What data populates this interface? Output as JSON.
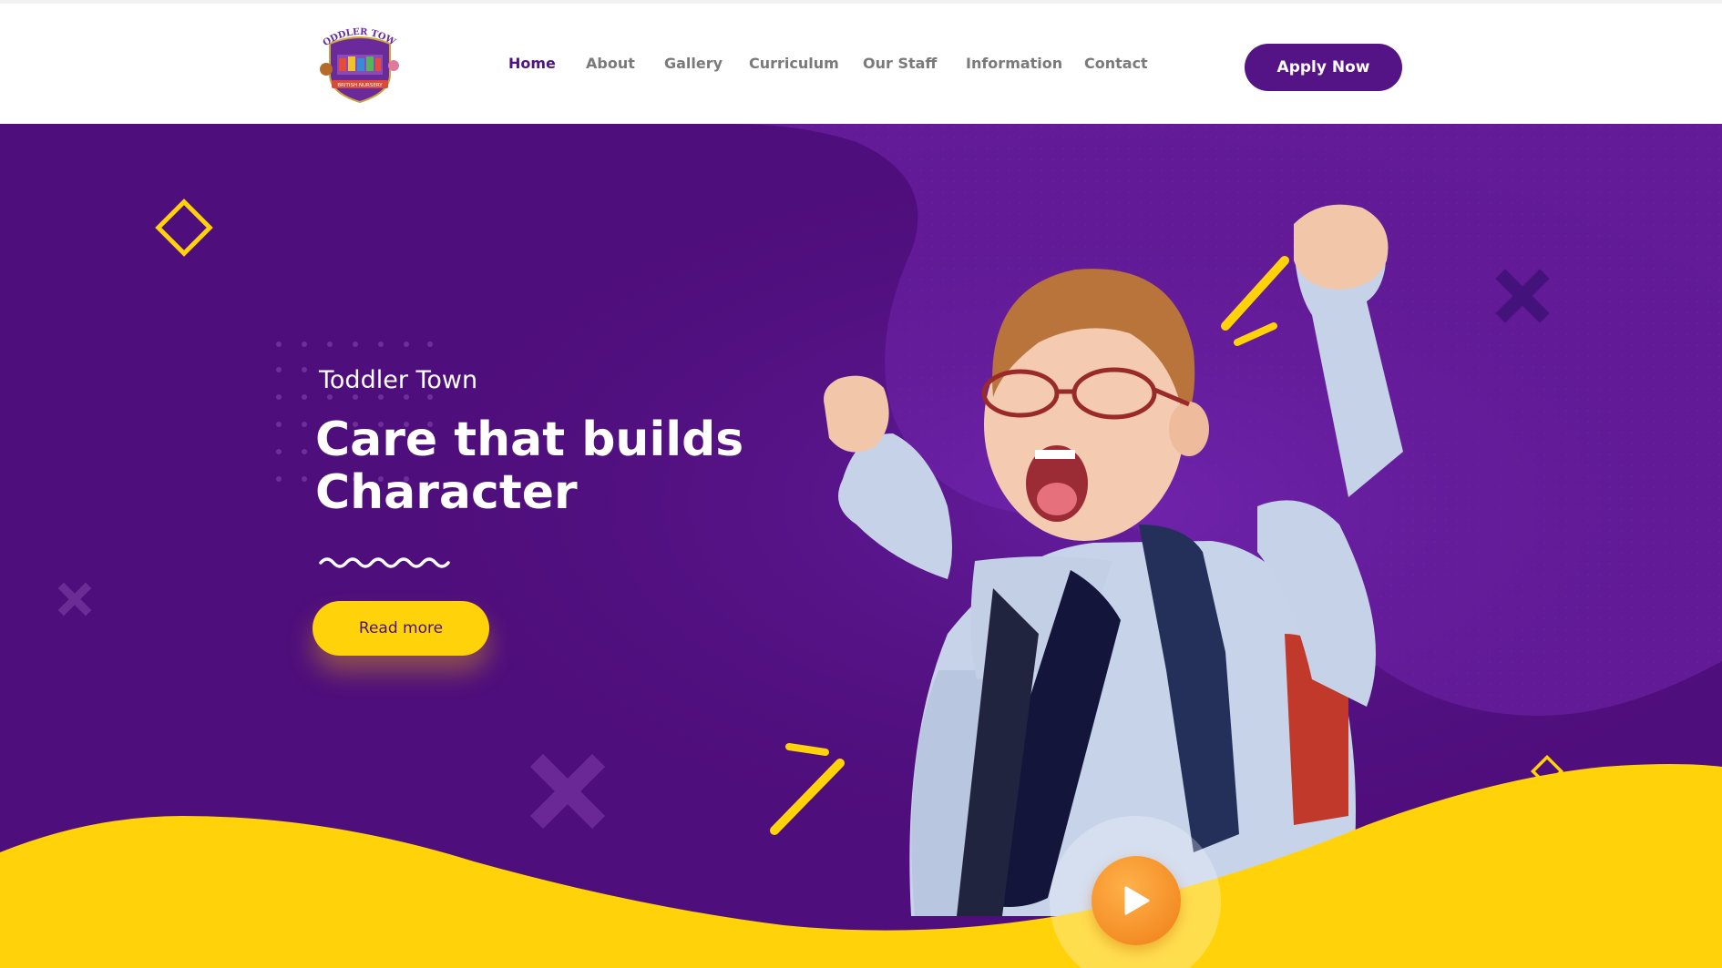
{
  "logo": {
    "top_text": "TODDLER TOWN",
    "banner_text": "BRITISH NURSERY"
  },
  "nav": {
    "items": [
      {
        "label": "Home",
        "active": true
      },
      {
        "label": "About",
        "active": false
      },
      {
        "label": "Gallery",
        "active": false
      },
      {
        "label": "Curriculum",
        "active": false
      },
      {
        "label": "Our Staff",
        "active": false
      },
      {
        "label": "Information",
        "active": false
      },
      {
        "label": "Contact",
        "active": false
      }
    ],
    "apply_label": "Apply Now"
  },
  "hero": {
    "brand": "Toddler Town",
    "headline_line1": "Care that builds",
    "headline_line2": "Character",
    "read_more_label": "Read more"
  },
  "colors": {
    "primary_purple": "#52107f",
    "button_purple": "#551486",
    "accent_yellow": "#ffd20a",
    "play_orange": "#f58a1f",
    "nav_active": "#4f1581",
    "nav_text": "#7a7a7a"
  },
  "icons": {
    "play": "play-icon",
    "diamond": "diamond-outline-icon",
    "cross": "x-cross-icon",
    "squiggle": "wave-divider-icon"
  }
}
